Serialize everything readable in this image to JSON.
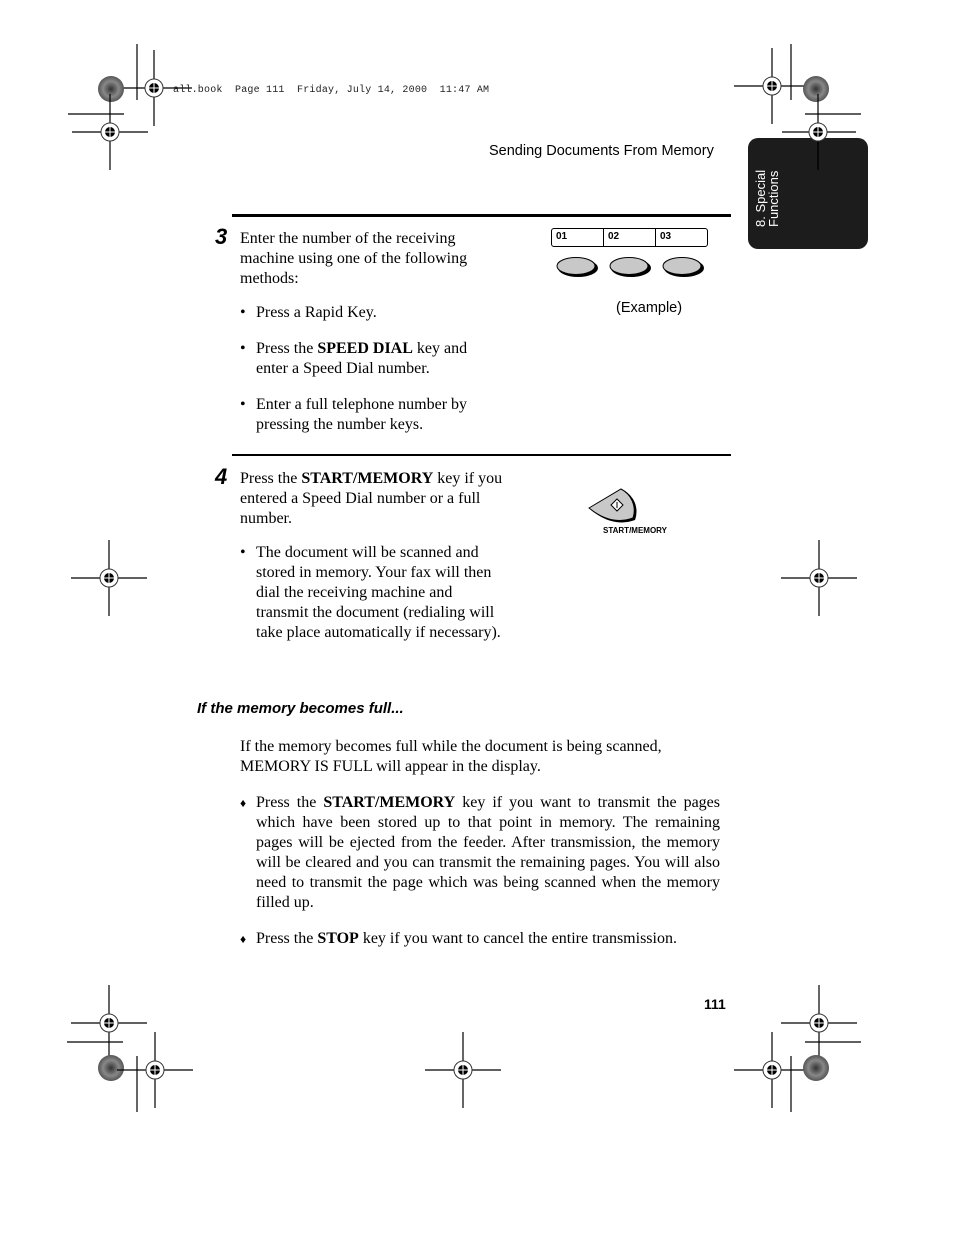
{
  "slug": {
    "text": "all.book  Page 111  Friday, July 14, 2000  11:47 AM"
  },
  "running_head": "Sending Documents From Memory",
  "chapter_tab": {
    "line1": "8. Special",
    "line2": "Functions"
  },
  "step3": {
    "number": "3",
    "intro": "Enter the number of the receiving machine using one of the following methods:",
    "bullets": [
      {
        "mark": "•",
        "pre": "Press a Rapid Key.",
        "bold": "",
        "post": ""
      },
      {
        "mark": "•",
        "pre": "Press the ",
        "bold": "SPEED DIAL",
        "post": " key and enter a Speed Dial number."
      },
      {
        "mark": "•",
        "pre": "Enter a full telephone number by pressing the number keys.",
        "bold": "",
        "post": ""
      }
    ],
    "illustration": {
      "rapid_keys": [
        "01",
        "02",
        "03"
      ],
      "caption": "(Example)"
    }
  },
  "step4": {
    "number": "4",
    "intro_pre": "Press the ",
    "intro_bold": "START/MEMORY",
    "intro_post": " key if you entered a Speed Dial number or a full number.",
    "bullets": [
      {
        "mark": "•",
        "text": "The document will be scanned and stored in memory. Your fax will then dial the receiving machine and transmit the document (redialing will take place automatically if necessary)."
      }
    ],
    "illustration": {
      "key_label": "START/MEMORY"
    }
  },
  "memory_full": {
    "heading": "If the memory becomes full...",
    "paragraph": "If the memory becomes full while the document is being scanned, MEMORY IS FULL will appear in the display.",
    "bullets": [
      {
        "mark": "♦",
        "pre": "Press the ",
        "bold": "START/MEMORY",
        "post": " key if you want to transmit the pages which have been stored up to that point in memory. The remaining pages will be ejected from the feeder. After transmission, the memory will be cleared and you can transmit the remaining pages. You will also need to transmit the page which was being scanned when the memory filled up."
      },
      {
        "mark": "♦",
        "pre": "Press the ",
        "bold": "STOP",
        "post": " key if you want to cancel the entire transmission."
      }
    ]
  },
  "page_number": "111"
}
